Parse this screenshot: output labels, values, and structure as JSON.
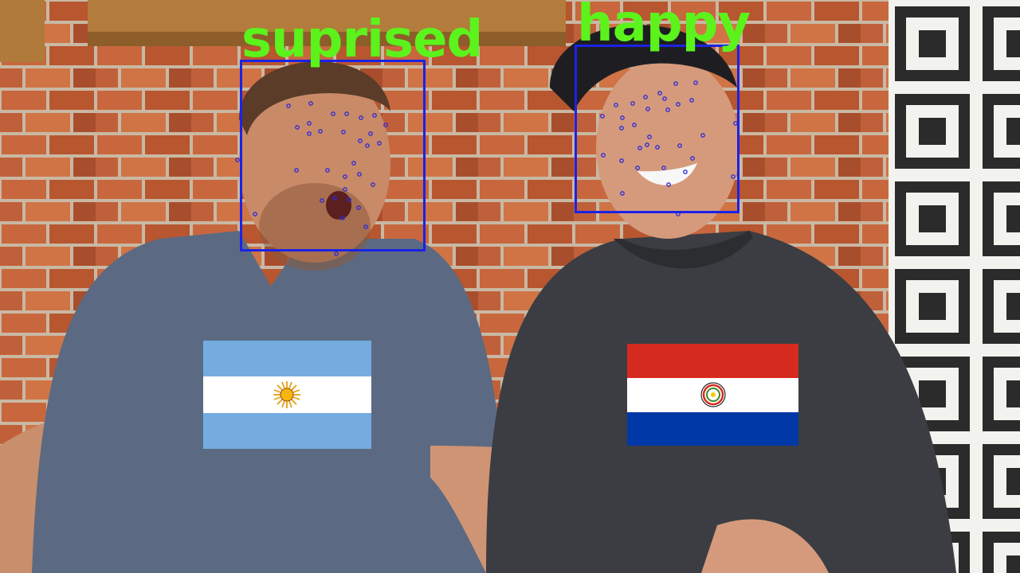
{
  "detections": [
    {
      "emotion_label": "suprised",
      "flag_icon": "argentina-flag-icon"
    },
    {
      "emotion_label": "happy",
      "flag_icon": "paraguay-flag-icon"
    }
  ],
  "colors": {
    "label_text": "#5cf21c",
    "face_box": "#1b22e6",
    "landmark_dot": "#2a2ad8",
    "argentina_blue": "#74acdf",
    "paraguay_red": "#d52b1e",
    "paraguay_blue": "#0038a8"
  }
}
